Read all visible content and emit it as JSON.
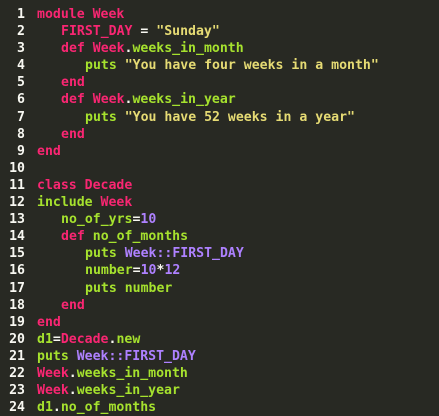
{
  "colors": {
    "background": "#282923",
    "keyword": "#f92672",
    "constant": "#ae81ff",
    "string": "#e6db74",
    "number": "#ae81ff",
    "function": "#a6e22e",
    "identifier": "#f8f8f2"
  },
  "lines": [
    {
      "num": "1",
      "indent": 0,
      "tokens": [
        {
          "t": "module Week",
          "k": "kw"
        }
      ]
    },
    {
      "num": "2",
      "indent": 3,
      "tokens": [
        {
          "t": "FIRST_DAY",
          "k": "kw"
        },
        {
          "t": " = ",
          "k": "op"
        },
        {
          "t": "\"Sunday\"",
          "k": "str"
        }
      ]
    },
    {
      "num": "3",
      "indent": 3,
      "tokens": [
        {
          "t": "def ",
          "k": "kw"
        },
        {
          "t": "Week",
          "k": "kw"
        },
        {
          "t": ".",
          "k": "op"
        },
        {
          "t": "weeks_in_month",
          "k": "fn"
        }
      ]
    },
    {
      "num": "4",
      "indent": 6,
      "tokens": [
        {
          "t": "puts ",
          "k": "fn"
        },
        {
          "t": "\"You have four weeks in a month\"",
          "k": "str"
        }
      ]
    },
    {
      "num": "5",
      "indent": 3,
      "tokens": [
        {
          "t": "end",
          "k": "kw"
        }
      ]
    },
    {
      "num": "6",
      "indent": 3,
      "tokens": [
        {
          "t": "def ",
          "k": "kw"
        },
        {
          "t": "Week",
          "k": "kw"
        },
        {
          "t": ".",
          "k": "op"
        },
        {
          "t": "weeks_in_year",
          "k": "fn"
        }
      ]
    },
    {
      "num": "7",
      "indent": 6,
      "tokens": [
        {
          "t": "puts ",
          "k": "fn"
        },
        {
          "t": "\"You have 52 weeks in a year\"",
          "k": "str"
        }
      ]
    },
    {
      "num": "8",
      "indent": 3,
      "tokens": [
        {
          "t": "end",
          "k": "kw"
        }
      ]
    },
    {
      "num": "9",
      "indent": 0,
      "tokens": [
        {
          "t": "end",
          "k": "kw"
        }
      ]
    },
    {
      "num": "10",
      "indent": 0,
      "tokens": []
    },
    {
      "num": "11",
      "indent": 0,
      "tokens": [
        {
          "t": "class Decade",
          "k": "kw"
        }
      ]
    },
    {
      "num": "12",
      "indent": 0,
      "tokens": [
        {
          "t": "include ",
          "k": "fn"
        },
        {
          "t": "Week",
          "k": "kw"
        }
      ]
    },
    {
      "num": "13",
      "indent": 3,
      "tokens": [
        {
          "t": "no_of_yrs",
          "k": "fn"
        },
        {
          "t": "=",
          "k": "op"
        },
        {
          "t": "10",
          "k": "num"
        }
      ]
    },
    {
      "num": "14",
      "indent": 3,
      "tokens": [
        {
          "t": "def ",
          "k": "kw"
        },
        {
          "t": "no_of_months",
          "k": "fn"
        }
      ]
    },
    {
      "num": "15",
      "indent": 6,
      "tokens": [
        {
          "t": "puts ",
          "k": "fn"
        },
        {
          "t": "Week::FIRST_DAY",
          "k": "const"
        }
      ]
    },
    {
      "num": "16",
      "indent": 6,
      "tokens": [
        {
          "t": "number",
          "k": "fn"
        },
        {
          "t": "=",
          "k": "op"
        },
        {
          "t": "10",
          "k": "num"
        },
        {
          "t": "*",
          "k": "op"
        },
        {
          "t": "12",
          "k": "num"
        }
      ]
    },
    {
      "num": "17",
      "indent": 6,
      "tokens": [
        {
          "t": "puts number",
          "k": "fn"
        }
      ]
    },
    {
      "num": "18",
      "indent": 3,
      "tokens": [
        {
          "t": "end",
          "k": "kw"
        }
      ]
    },
    {
      "num": "19",
      "indent": 0,
      "tokens": [
        {
          "t": "end",
          "k": "kw"
        }
      ]
    },
    {
      "num": "20",
      "indent": 0,
      "tokens": [
        {
          "t": "d1",
          "k": "fn"
        },
        {
          "t": "=",
          "k": "op"
        },
        {
          "t": "Decade",
          "k": "kw"
        },
        {
          "t": ".",
          "k": "op"
        },
        {
          "t": "new",
          "k": "fn"
        }
      ]
    },
    {
      "num": "21",
      "indent": 0,
      "tokens": [
        {
          "t": "puts ",
          "k": "fn"
        },
        {
          "t": "Week::FIRST_DAY",
          "k": "const"
        }
      ]
    },
    {
      "num": "22",
      "indent": 0,
      "tokens": [
        {
          "t": "Week",
          "k": "kw"
        },
        {
          "t": ".",
          "k": "op"
        },
        {
          "t": "weeks_in_month",
          "k": "fn"
        }
      ]
    },
    {
      "num": "23",
      "indent": 0,
      "tokens": [
        {
          "t": "Week",
          "k": "kw"
        },
        {
          "t": ".",
          "k": "op"
        },
        {
          "t": "weeks_in_year",
          "k": "fn"
        }
      ]
    },
    {
      "num": "24",
      "indent": 0,
      "tokens": [
        {
          "t": "d1",
          "k": "fn"
        },
        {
          "t": ".",
          "k": "op"
        },
        {
          "t": "no_of_months",
          "k": "fn"
        }
      ]
    }
  ]
}
